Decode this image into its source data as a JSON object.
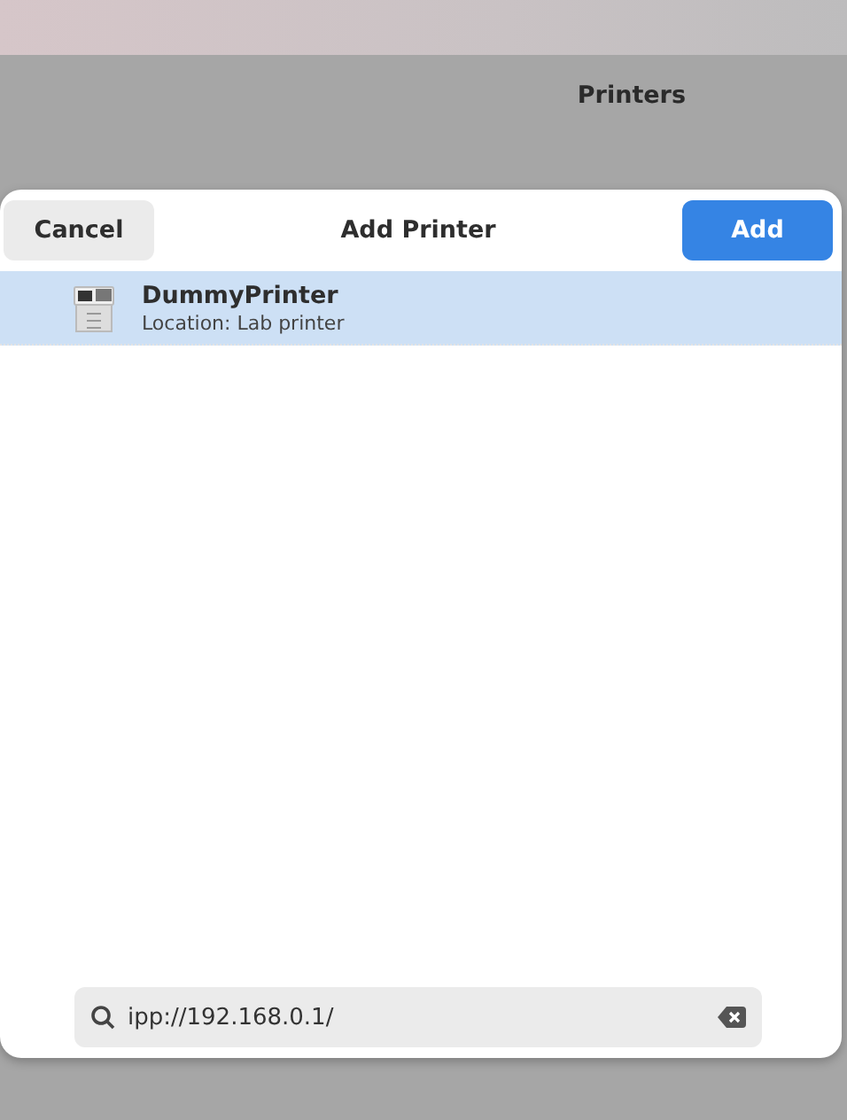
{
  "window": {
    "title": "Printers"
  },
  "dialog": {
    "title": "Add Printer",
    "cancel_button": "Cancel",
    "add_button": "Add"
  },
  "printers": [
    {
      "name": "DummyPrinter",
      "location": "Location: Lab printer",
      "selected": true
    }
  ],
  "search": {
    "value": "ipp://192.168.0.1/"
  }
}
